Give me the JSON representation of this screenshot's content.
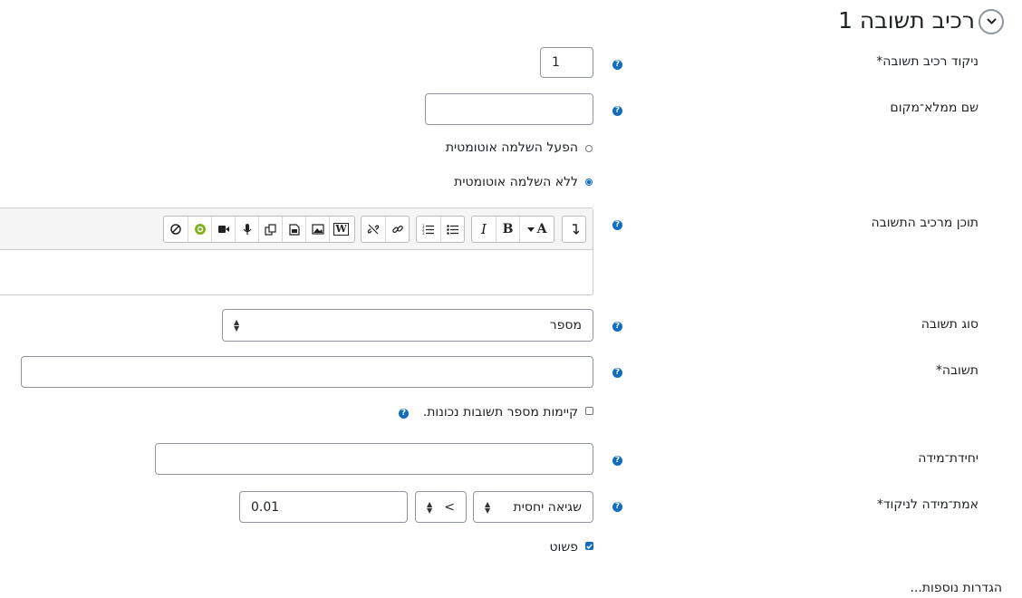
{
  "section": {
    "title": "רכיב תשובה 1",
    "collapse_icon": "chevron-down-icon"
  },
  "help_glyph": "?",
  "fields": {
    "grade": {
      "label": "ניקוד רכיב תשובה*",
      "value": "1"
    },
    "placeholder_name": {
      "label": "שם ממלא־מקום",
      "value": ""
    },
    "autocomplete": {
      "options": [
        {
          "label": "הפעל השלמה אוטומטית",
          "checked": false
        },
        {
          "label": "ללא השלמה אוטומטית",
          "checked": true
        }
      ]
    },
    "content": {
      "label": "תוכן מרכיב התשובה",
      "toolbar_icons": [
        "show-more-icon",
        "font-style-icon",
        "bold-icon",
        "italic-icon",
        "unordered-list-icon",
        "ordered-list-icon",
        "link-icon",
        "unlink-icon",
        "word-import-icon",
        "image-icon",
        "media-icon",
        "copy-icon",
        "record-audio-icon",
        "record-video-icon",
        "h5p-icon",
        "accessibility-checker-icon"
      ],
      "bold_glyph": "B",
      "italic_glyph": "I",
      "font_glyph": "A",
      "word_glyph": "W"
    },
    "answer_type": {
      "label": "סוג תשובה",
      "selected": "מספר"
    },
    "answer": {
      "label": "תשובה*",
      "value": ""
    },
    "multiple_answers": {
      "label": "קיימות מספר תשובות נכונות.",
      "checked": false
    },
    "unit": {
      "label": "יחידת־מידה",
      "value": ""
    },
    "grading_measure": {
      "label": "אמת־מידה לניקוד*",
      "error_type": "שגיאה יחסית",
      "comparator": "<",
      "tolerance": "0.01"
    },
    "simple": {
      "label": "פשוט",
      "checked": true
    }
  },
  "more_settings": "הגדרות נוספות...",
  "colors": {
    "accent": "#0f6cbf",
    "border": "#8f959e",
    "text": "#1d2125"
  }
}
